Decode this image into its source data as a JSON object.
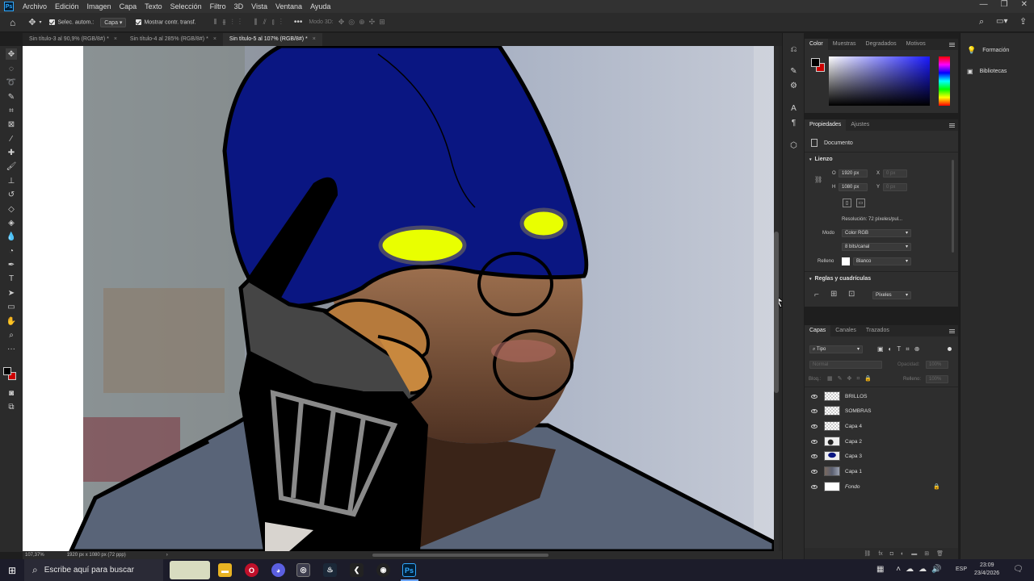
{
  "app": {
    "menu": [
      "Archivo",
      "Edición",
      "Imagen",
      "Capa",
      "Texto",
      "Selección",
      "Filtro",
      "3D",
      "Vista",
      "Ventana",
      "Ayuda"
    ]
  },
  "options_bar": {
    "auto_select_label": "Selec. autom.:",
    "auto_select_value": "Capa",
    "show_transform_label": "Mostrar contr. transf.",
    "mode_3d_label": "Modo 3D:"
  },
  "tabs": [
    {
      "label": "Sin título-3 al 90,9% (RGB/8#) *",
      "active": false
    },
    {
      "label": "Sin título-4 al 285% (RGB/8#) *",
      "active": false
    },
    {
      "label": "Sin título-5 al 107% (RGB/8#) *",
      "active": true
    }
  ],
  "status": {
    "zoom": "107,37%",
    "doc_info": "1920 px x 1080 px (72 ppp)"
  },
  "color_panel": {
    "tabs": [
      "Color",
      "Muestras",
      "Degradados",
      "Motivos"
    ],
    "foreground": "#000000",
    "background": "#cc0000",
    "hue_color": "#1a1aff"
  },
  "properties_panel": {
    "tabs": [
      "Propiedades",
      "Ajustes"
    ],
    "doc_label": "Documento",
    "lienzo_title": "Lienzo",
    "width_label": "Ο",
    "width_value": "1920 px",
    "height_label": "H",
    "height_value": "1080 px",
    "x_label": "X",
    "x_value": "0 px",
    "y_label": "Y",
    "y_value": "0 px",
    "resolution": "Resolución: 72 píxeles/pul...",
    "mode_label": "Modo",
    "mode_value": "Color RGB",
    "depth_value": "8 bits/canal",
    "fill_label": "Relleno",
    "fill_value": "Blanco",
    "rulers_title": "Reglas y cuadrículas",
    "units_value": "Píxeles"
  },
  "layers_panel": {
    "tabs": [
      "Capas",
      "Canales",
      "Trazados"
    ],
    "filter_value": "Tipo",
    "blend_value": "Normal",
    "opacity_label": "Opacidad:",
    "opacity_value": "100%",
    "lock_label": "Bloq.:",
    "fill_label": "Relleno:",
    "fill_value": "100%",
    "layers": [
      {
        "name": "BRILLOS"
      },
      {
        "name": "SOMBRAS"
      },
      {
        "name": "Capa 4"
      },
      {
        "name": "Capa 2"
      },
      {
        "name": "Capa 3"
      },
      {
        "name": "Capa 1"
      },
      {
        "name": "Fondo"
      }
    ]
  },
  "learn_panel": {
    "items": [
      "Formación",
      "Bibliotecas"
    ]
  },
  "taskbar": {
    "search_placeholder": "Escribe aquí para buscar",
    "lang": "ESP",
    "time": "23:09",
    "date": "23/4/2026"
  }
}
